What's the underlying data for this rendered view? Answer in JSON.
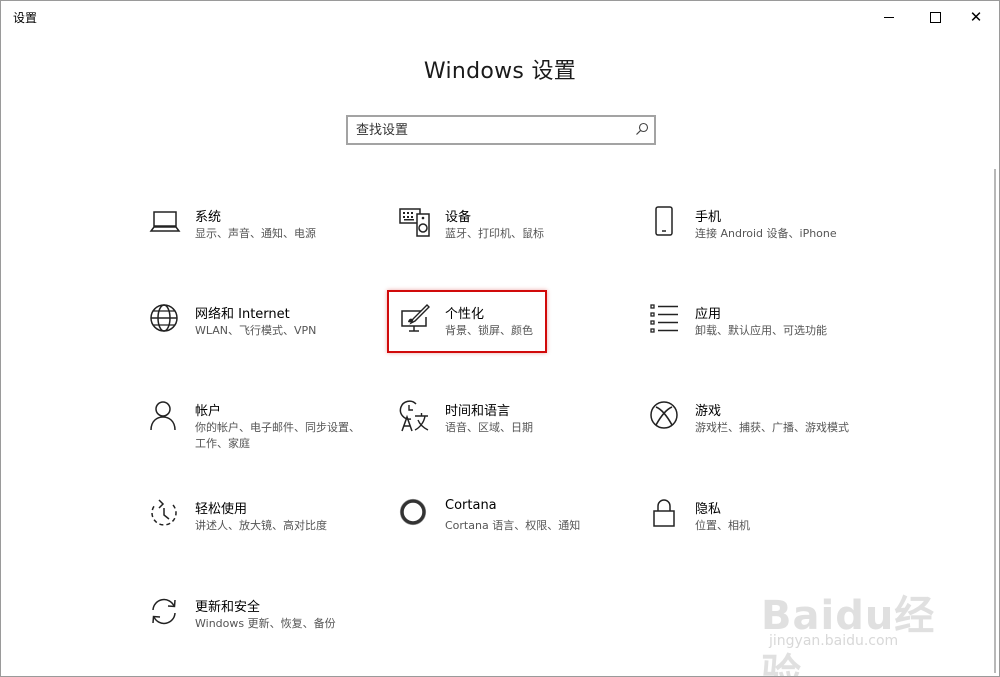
{
  "window": {
    "title": "设置"
  },
  "controls": {
    "minimize": "minimize",
    "maximize": "maximize",
    "close": "✕"
  },
  "header": {
    "title": "Windows 设置"
  },
  "search": {
    "placeholder": "查找设置",
    "value": ""
  },
  "tiles": [
    {
      "id": "system",
      "name": "系统",
      "desc": "显示、声音、通知、电源",
      "icon": "laptop-icon"
    },
    {
      "id": "devices",
      "name": "设备",
      "desc": "蓝牙、打印机、鼠标",
      "icon": "devices-icon"
    },
    {
      "id": "phone",
      "name": "手机",
      "desc": "连接 Android 设备、iPhone",
      "icon": "phone-icon"
    },
    {
      "id": "network",
      "name": "网络和 Internet",
      "desc": "WLAN、飞行模式、VPN",
      "icon": "globe-icon"
    },
    {
      "id": "personalization",
      "name": "个性化",
      "desc": "背景、锁屏、颜色",
      "icon": "personalization-icon"
    },
    {
      "id": "apps",
      "name": "应用",
      "desc": "卸载、默认应用、可选功能",
      "icon": "apps-list-icon"
    },
    {
      "id": "accounts",
      "name": "帐户",
      "desc": "你的帐户、电子邮件、同步设置、工作、家庭",
      "icon": "person-icon"
    },
    {
      "id": "time-language",
      "name": "时间和语言",
      "desc": "语音、区域、日期",
      "icon": "time-language-icon"
    },
    {
      "id": "gaming",
      "name": "游戏",
      "desc": "游戏栏、捕获、广播、游戏模式",
      "icon": "xbox-icon"
    },
    {
      "id": "ease-of-access",
      "name": "轻松使用",
      "desc": "讲述人、放大镜、高对比度",
      "icon": "ease-of-access-icon"
    },
    {
      "id": "cortana",
      "name": "Cortana",
      "desc": "Cortana 语言、权限、通知",
      "icon": "cortana-icon"
    },
    {
      "id": "privacy",
      "name": "隐私",
      "desc": "位置、相机",
      "icon": "lock-icon"
    },
    {
      "id": "update-security",
      "name": "更新和安全",
      "desc": "Windows 更新、恢复、备份",
      "icon": "sync-icon"
    }
  ],
  "watermark": {
    "logo": "Baidu经验",
    "url": "jingyan.baidu.com"
  },
  "colors": {
    "highlight": "#d10a0a",
    "text": "#000000",
    "secondary_text": "#555555"
  }
}
